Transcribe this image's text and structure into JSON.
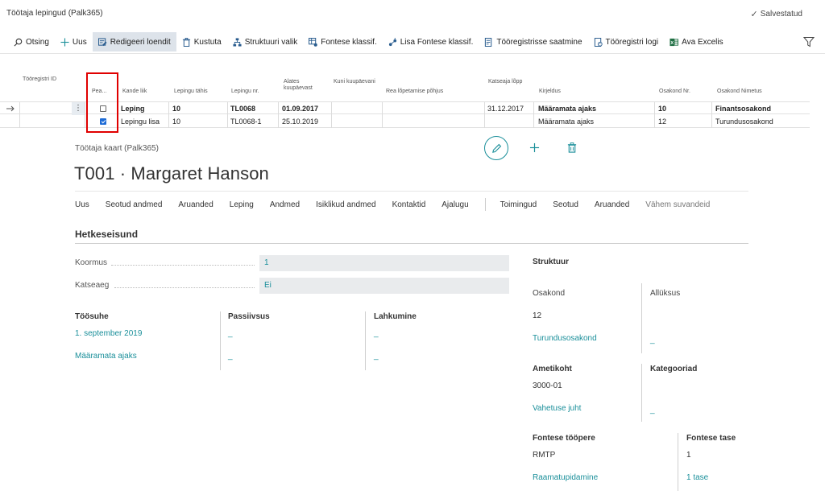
{
  "page": {
    "title": "Töötaja lepingud (Palk365)",
    "saved_label": "Salvestatud"
  },
  "toolbar": {
    "items": [
      {
        "label": "Otsing",
        "icon": "search-icon"
      },
      {
        "label": "Uus",
        "icon": "plus-icon"
      },
      {
        "label": "Redigeeri loendit",
        "icon": "edit-list-icon"
      },
      {
        "label": "Kustuta",
        "icon": "trash-icon"
      },
      {
        "label": "Struktuuri valik",
        "icon": "hierarchy-icon"
      },
      {
        "label": "Fontese klassif.",
        "icon": "table-icon"
      },
      {
        "label": "Lisa Fontese klassif.",
        "icon": "add-class-icon"
      },
      {
        "label": "Tööregistrisse saatmine",
        "icon": "document-icon"
      },
      {
        "label": "Tööregistri logi",
        "icon": "log-icon"
      },
      {
        "label": "Ava Excelis",
        "icon": "excel-icon"
      }
    ]
  },
  "table": {
    "headers": {
      "register_id": "Tööregistri ID",
      "main": "Pea...",
      "entry_type": "Kande liik",
      "contract_code": "Lepingu tähis",
      "contract_no": "Lepingu nr.",
      "from_date": "Alates kuupäevast",
      "to_date": "Kuni kuupäevani",
      "line_end_reason": "Rea lõpetamise põhjus",
      "probation_end": "Katseaja lõpp",
      "description": "Kirjeldus",
      "dept_no": "Osakond Nr.",
      "dept_name": "Osakond Nimetus"
    },
    "rows": [
      {
        "main": false,
        "entry_type": "Leping",
        "contract_code": "10",
        "contract_no": "TL0068",
        "from_date": "01.09.2017",
        "to_date": "",
        "line_end_reason": "",
        "probation_end": "31.12.2017",
        "description": "Määramata ajaks",
        "dept_no": "10",
        "dept_name": "Finantsosakond"
      },
      {
        "main": true,
        "entry_type": "Lepingu lisa",
        "contract_code": "10",
        "contract_no": "TL0068-1",
        "from_date": "25.10.2019",
        "to_date": "",
        "line_end_reason": "",
        "probation_end": "",
        "description": "Määramata ajaks",
        "dept_no": "12",
        "dept_name": "Turundusosakond"
      }
    ]
  },
  "card": {
    "title": "Töötaja kaart (Palk365)",
    "heading": "T001 · Margaret Hanson",
    "nav": [
      "Uus",
      "Seotud andmed",
      "Aruanded",
      "Leping",
      "Andmed",
      "Isiklikud andmed",
      "Kontaktid",
      "Ajalugu"
    ],
    "nav2": [
      "Toimingud",
      "Seotud",
      "Aruanded"
    ],
    "nav_less": "Vähem suvandeid",
    "section": "Hetkeseisund",
    "fields": {
      "load_label": "Koormus",
      "load_value": "1",
      "probation_label": "Katseaeg",
      "probation_value": "Ei"
    },
    "employment": {
      "title": "Töösuhe",
      "start": "1. september 2019",
      "duration": "Määramata ajaks"
    },
    "passive": {
      "title": "Passiivsus",
      "v1": "_",
      "v2": "_"
    },
    "leaving": {
      "title": "Lahkumine",
      "v1": "_",
      "v2": "_"
    },
    "structure": {
      "title": "Struktuur",
      "dept_label": "Osakond",
      "unit_label": "Allüksus",
      "dept_no": "12",
      "dept_name": "Turundusosakond",
      "unit_value": "_"
    },
    "position": {
      "title": "Ametikoht",
      "code": "3000-01",
      "name": "Vahetuse juht"
    },
    "categories": {
      "title": "Kategooriad",
      "value": "_"
    },
    "fontes_group": {
      "title": "Fontese tööpere",
      "code": "RMTP",
      "name": "Raamatupidamine"
    },
    "fontes_level": {
      "title": "Fontese tase",
      "code": "1",
      "name": "1 tase"
    }
  },
  "colors": {
    "accent": "#1a8f9a",
    "highlight": "#e00000",
    "checkbox": "#1d6bd6"
  }
}
